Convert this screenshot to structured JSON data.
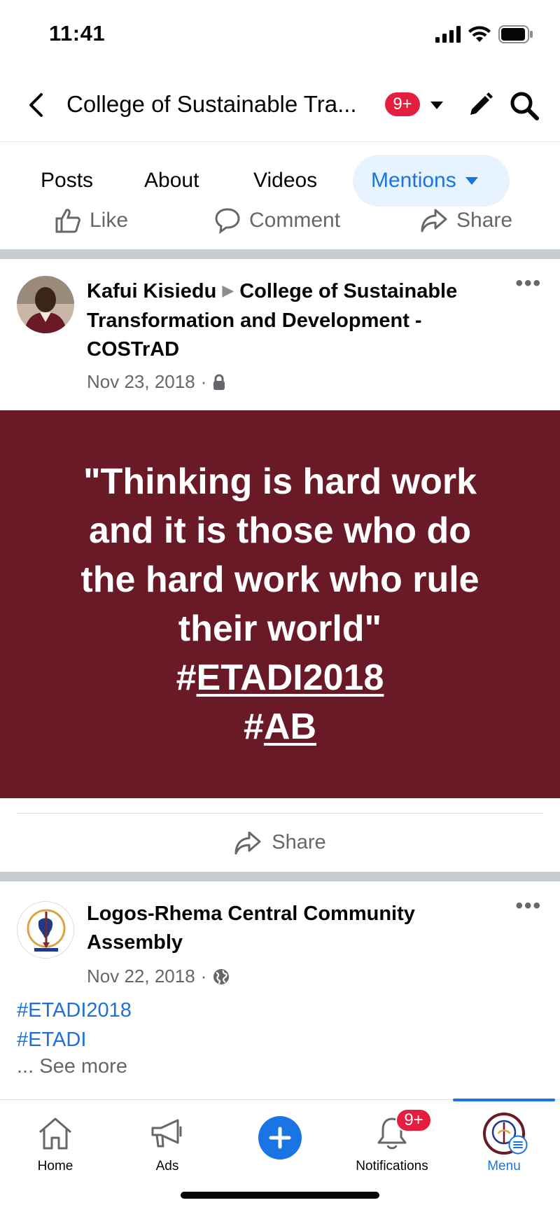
{
  "status_bar": {
    "time": "11:41"
  },
  "header": {
    "title": "College of Sustainable Tra...",
    "badge": "9+"
  },
  "tabs": {
    "posts": "Posts",
    "about": "About",
    "videos": "Videos",
    "mentions": "Mentions"
  },
  "post_actions": {
    "like": "Like",
    "comment": "Comment",
    "share": "Share"
  },
  "posts": [
    {
      "author": "Kafui Kisiedu",
      "target": "College of Sustainable Transformation and Development - COSTrAD",
      "date": "Nov 23, 2018",
      "privacy_icon": "lock-icon",
      "quote_lines": [
        "\"Thinking is hard work",
        "and it is those who do",
        "the hard work who rule",
        "their world\""
      ],
      "quote_tags": [
        {
          "hash": "#",
          "tag": "ETADI2018"
        },
        {
          "hash": "#",
          "tag": "AB"
        }
      ],
      "share_label": "Share",
      "card_color": "#6a1a27"
    },
    {
      "author": "Logos-Rhema Central Community Assembly",
      "date": "Nov 22, 2018",
      "privacy_icon": "globe-icon",
      "hashtags": [
        "#ETADI2018",
        "#ETADI"
      ],
      "see_more": "... See more"
    }
  ],
  "bottom_nav": {
    "home": "Home",
    "ads": "Ads",
    "notifications": "Notifications",
    "notifications_badge": "9+",
    "menu": "Menu"
  },
  "colors": {
    "accent": "#1b74e4",
    "badge": "#e41e3f",
    "muted": "#65676b",
    "divider": "#c9ccd1"
  }
}
